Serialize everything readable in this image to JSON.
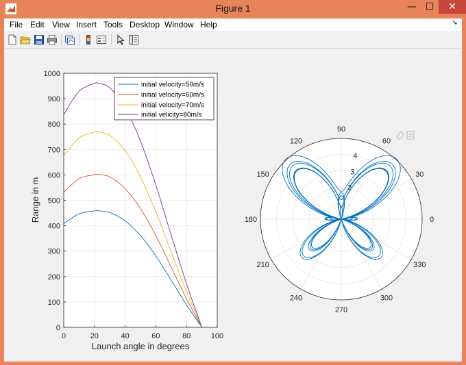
{
  "window": {
    "title": "Figure 1",
    "minimize_glyph": "—",
    "maximize_glyph": "☐",
    "close_glyph": "✕"
  },
  "menu": {
    "items": [
      "File",
      "Edit",
      "View",
      "Insert",
      "Tools",
      "Desktop",
      "Window",
      "Help"
    ]
  },
  "toolbar": {
    "icons": [
      "new-figure-icon",
      "open-file-icon",
      "save-icon",
      "print-icon",
      "link-plot-icon",
      "colorbar-icon",
      "legend-icon",
      "pointer-icon",
      "property-inspector-icon"
    ]
  },
  "colors": {
    "series": [
      "#0072BD",
      "#D95319",
      "#EDB120",
      "#7E2F8E"
    ],
    "polar": "#0072BD",
    "grid": "#e6e6e6",
    "axis": "#262626"
  },
  "chart_data": [
    {
      "type": "line",
      "xlabel": "Launch angle in degrees",
      "ylabel": "Range in m",
      "xlim": [
        0,
        100
      ],
      "ylim": [
        0,
        1000
      ],
      "xticks": [
        0,
        20,
        40,
        60,
        80,
        100
      ],
      "yticks": [
        0,
        100,
        200,
        300,
        400,
        500,
        600,
        700,
        800,
        900,
        1000
      ],
      "grid": true,
      "legend_position": "top-right",
      "series": [
        {
          "name": "initial velocity=50m/s",
          "x": [
            0,
            10,
            20,
            22,
            30,
            40,
            50,
            60,
            70,
            80,
            90
          ],
          "y": [
            408,
            447,
            458,
            459,
            452,
            419,
            361,
            281,
            186,
            88,
            0
          ]
        },
        {
          "name": "initial velocity=60m/s",
          "x": [
            0,
            10,
            20,
            22,
            30,
            40,
            50,
            60,
            70,
            80,
            90
          ],
          "y": [
            532,
            585,
            601,
            602,
            592,
            546,
            468,
            361,
            237,
            112,
            0
          ]
        },
        {
          "name": "initial velocity=70m/s",
          "x": [
            0,
            10,
            20,
            22,
            30,
            40,
            50,
            60,
            70,
            80,
            90
          ],
          "y": [
            676,
            746,
            769,
            770,
            756,
            695,
            592,
            455,
            297,
            140,
            0
          ]
        },
        {
          "name": "initial velicity=80m/s",
          "x": [
            0,
            10,
            20,
            22,
            30,
            40,
            50,
            60,
            70,
            80,
            90
          ],
          "y": [
            837,
            929,
            960,
            961,
            943,
            864,
            733,
            560,
            363,
            171,
            0
          ]
        }
      ]
    },
    {
      "type": "polar",
      "curve": "butterfly",
      "rticks": [
        1,
        2,
        3,
        4
      ],
      "rmax": 5,
      "theta_labels": [
        "0",
        "30",
        "60",
        "90",
        "120",
        "150",
        "180",
        "210",
        "240",
        "270",
        "300",
        "330"
      ],
      "theta_degrees": [
        0,
        30,
        60,
        90,
        120,
        150,
        180,
        210,
        240,
        270,
        300,
        330
      ]
    }
  ]
}
